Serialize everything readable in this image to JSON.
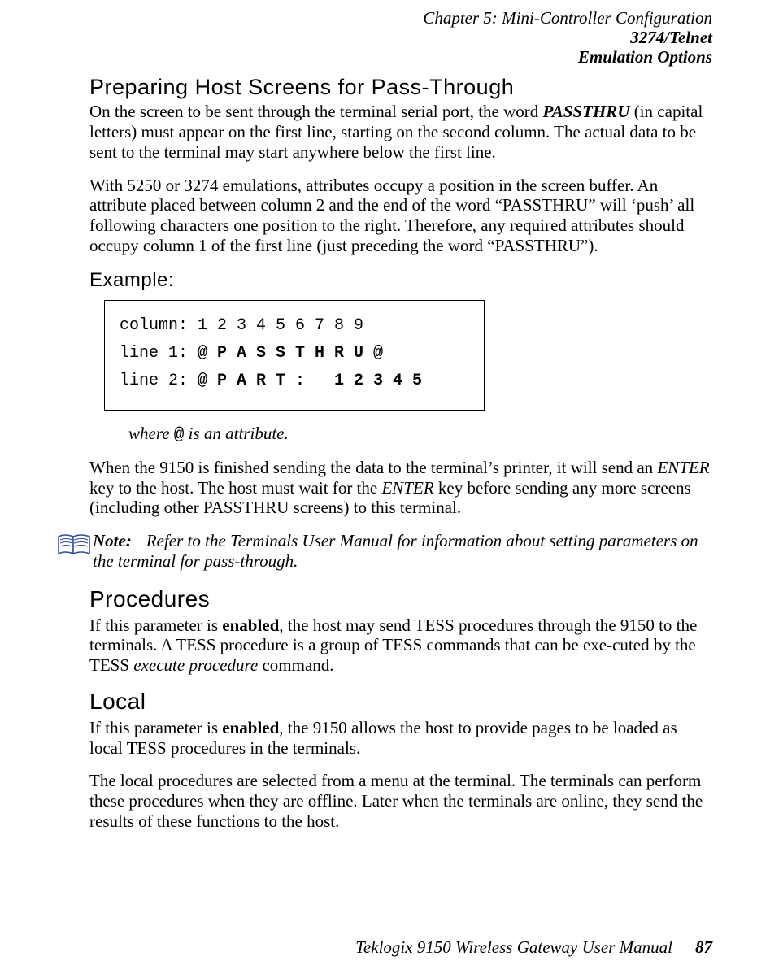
{
  "header": {
    "line1": "Chapter 5:  Mini-Controller Configuration",
    "line2": "3274/Telnet",
    "line3": "Emulation Options"
  },
  "s1": {
    "heading": "Preparing Host Screens for Pass-Through",
    "p1a": "On the screen to be sent through the terminal serial port, the word ",
    "p1b": "PASSTHRU",
    "p1c": " (in capital letters) must appear on the first line, starting on the second column. The actual data to be sent to the terminal may start anywhere below the first line.",
    "p2": "With 5250 or 3274 emulations, attributes occupy a position in the screen buffer. An attribute placed between column 2 and the end of the word “PASSTHRU” will ‘push’ all following characters one position to the right. Therefore, any required attributes should occupy column 1 of the first line (just preceding the word “PASSTHRU”)."
  },
  "example": {
    "label": "Example:",
    "col_lead": "column: ",
    "col_vals": "1 2 3 4 5 6 7 8 9",
    "l1_lead": "line 1: ",
    "l1_vals": "@ P A S S T H R U @",
    "l2_lead": "line 2: ",
    "l2_vals": "@ P A R T :   1 2 3 4 5",
    "where_a": "where ",
    "where_b": "@",
    "where_c": " is an attribute."
  },
  "s1b": {
    "p3a": "When the 9150 is finished sending the data to the terminal’s printer, it will send an ",
    "p3b": "ENTER",
    "p3c": " key to the host. The host must wait for the ",
    "p3d": "ENTER",
    "p3e": " key before sending any more screens (including other PASSTHRU screens) to this terminal."
  },
  "note": {
    "label": "Note:",
    "text": "Refer to the Terminals User Manual for information about setting parameters on the terminal for pass-through."
  },
  "s2": {
    "heading": "Procedures",
    "p1a": "If this parameter is ",
    "p1b": "enabled",
    "p1c": ", the host may send TESS procedures through the 9150 to the terminals. A TESS procedure is a group of TESS commands that can be exe-cuted by the TESS ",
    "p1d": "execute procedure",
    "p1e": " command."
  },
  "s3": {
    "heading": "Local",
    "p1a": "If this parameter is ",
    "p1b": "enabled",
    "p1c": ", the 9150 allows the host to provide pages to be loaded as local TESS procedures in the terminals.",
    "p2": "The local procedures are selected from a menu at the terminal. The terminals can perform these procedures when they are offline. Later when the terminals are online, they send the results of these functions to the host."
  },
  "footer": {
    "text": "Teklogix 9150 Wireless Gateway User Manual",
    "page": "87"
  }
}
